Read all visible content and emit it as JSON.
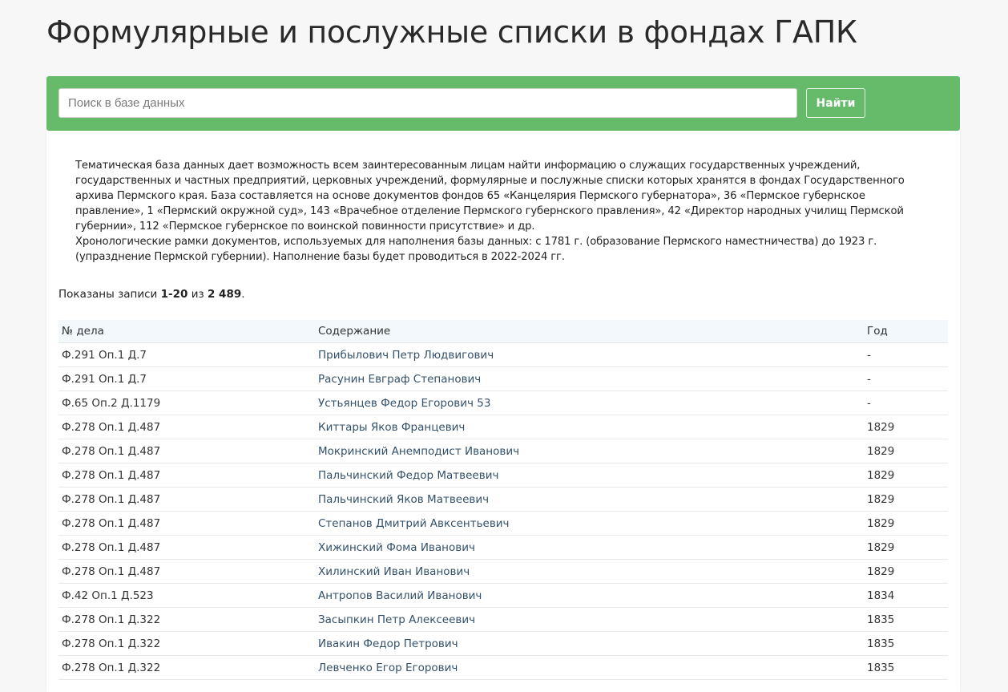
{
  "page": {
    "title": "Формулярные и послужные списки в фондах ГАПК"
  },
  "search": {
    "placeholder": "Поиск в базе данных",
    "value": "",
    "button_label": "Найти"
  },
  "description": {
    "paragraph1": "Тематическая база данных дает возможность всем заинтересованным лицам найти информацию о служащих государственных учреждений, государственных и частных предприятий, церковных учреждений, формулярные и послужные списки которых хранятся в фондах Государственного архива Пермского края. База составляется на основе документов фондов 65 «Канцелярия Пермского губернатора», 36 «Пермское губернское правление», 1 «Пермский окружной суд», 143 «Врачебное отделение Пермского губернского правления», 42 «Директор народных училищ Пермской губернии», 112 «Пермское губернское по воинской повинности присутствие» и др.",
    "paragraph2": "Хронологические рамки документов, используемых для наполнения базы данных: с 1781 г. (образование Пермского наместничества) до 1923 г. (упразднение Пермской губернии). Наполнение базы будет проводиться в 2022-2024 гг."
  },
  "summary": {
    "prefix": "Показаны записи ",
    "range": "1-20",
    "middle": " из ",
    "total": "2 489",
    "suffix": "."
  },
  "table": {
    "headers": [
      "№ дела",
      "Содержание",
      "Год"
    ],
    "rows": [
      {
        "case": "Ф.291 Оп.1 Д.7",
        "content": "Прибылович Петр Людвигович",
        "year": "-"
      },
      {
        "case": "Ф.291 Оп.1 Д.7",
        "content": "Расунин Евграф Степанович",
        "year": "-"
      },
      {
        "case": "Ф.65 Оп.2 Д.1179",
        "content": "Устьянцев Федор Егорович 53",
        "year": "-"
      },
      {
        "case": "Ф.278 Оп.1 Д.487",
        "content": "Киттары Яков Францевич",
        "year": "1829"
      },
      {
        "case": "Ф.278 Оп.1 Д.487",
        "content": "Мокринский Анемподист Иванович",
        "year": "1829"
      },
      {
        "case": "Ф.278 Оп.1 Д.487",
        "content": "Пальчинский Федор Матвеевич",
        "year": "1829"
      },
      {
        "case": "Ф.278 Оп.1 Д.487",
        "content": "Пальчинский Яков Матвеевич",
        "year": "1829"
      },
      {
        "case": "Ф.278 Оп.1 Д.487",
        "content": "Степанов Дмитрий Авксентьевич",
        "year": "1829"
      },
      {
        "case": "Ф.278 Оп.1 Д.487",
        "content": "Хижинский Фома Иванович",
        "year": "1829"
      },
      {
        "case": "Ф.278 Оп.1 Д.487",
        "content": "Хилинский Иван Иванович",
        "year": "1829"
      },
      {
        "case": "Ф.42 Оп.1 Д.523",
        "content": "Антропов Василий Иванович",
        "year": "1834"
      },
      {
        "case": "Ф.278 Оп.1 Д.322",
        "content": "Засыпкин Петр Алексеевич",
        "year": "1835"
      },
      {
        "case": "Ф.278 Оп.1 Д.322",
        "content": "Ивакин Федор Петрович",
        "year": "1835"
      },
      {
        "case": "Ф.278 Оп.1 Д.322",
        "content": "Левченко Егор Егорович",
        "year": "1835"
      }
    ]
  },
  "colors": {
    "accent_green": "#66bb6a",
    "link_blue": "#34516b",
    "header_bg": "#f3f8fc"
  }
}
